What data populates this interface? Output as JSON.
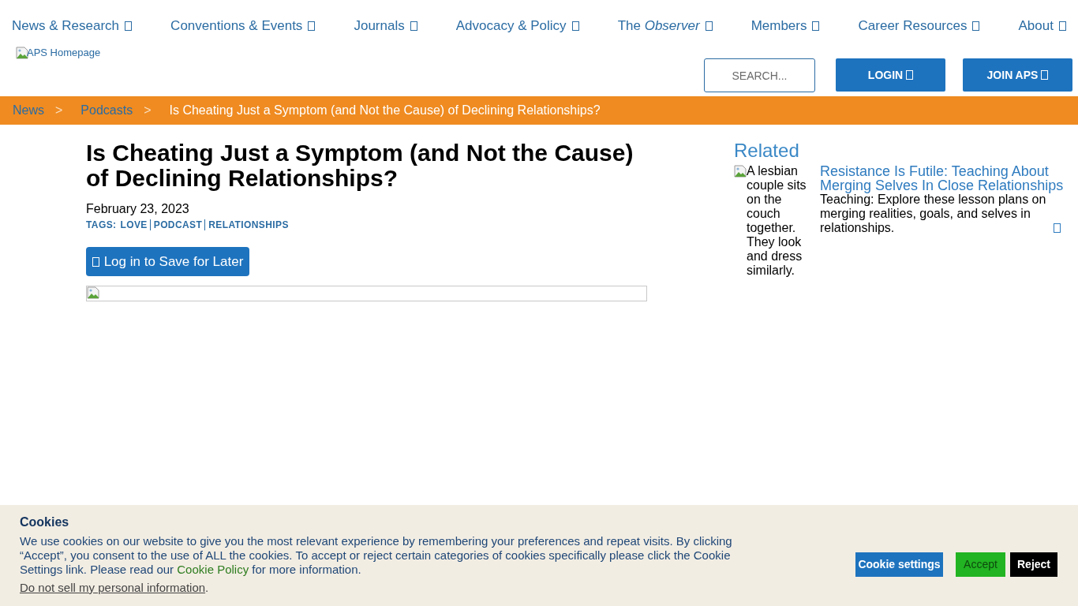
{
  "nav": {
    "items": [
      {
        "label": "News & Research"
      },
      {
        "label": "Conventions & Events"
      },
      {
        "label": "Journals"
      },
      {
        "label": "Advocacy & Policy"
      },
      {
        "label": "The *Observer*"
      },
      {
        "label": "Members"
      },
      {
        "label": "Career Resources"
      },
      {
        "label": "About"
      }
    ]
  },
  "header": {
    "logo_alt": "APS Homepage",
    "search": {
      "placeholder": "SEARCH..."
    },
    "buttons": [
      {
        "label": "LOGIN"
      },
      {
        "label": "JOIN APS"
      }
    ]
  },
  "breadcrumb": [
    {
      "label": "News",
      "kind": "link"
    },
    {
      "label": ">",
      "kind": "separator"
    },
    {
      "label": "Podcasts",
      "kind": "link"
    },
    {
      "label": ">",
      "kind": "separator"
    },
    {
      "label": "Is Cheating Just a Symptom (and Not the Cause) of Declining Relationships?",
      "kind": "current"
    }
  ],
  "article": {
    "title": "Is Cheating Just a Symptom (and Not the Cause) of Declining Relationships?",
    "date": "February 23, 2023",
    "tags_label": "TAGS:",
    "tags": [
      "LOVE",
      "PODCAST",
      "RELATIONSHIPS"
    ],
    "save_button": "Log in to Save for Later"
  },
  "related": {
    "heading": "Related",
    "items": [
      {
        "image_alt": "A lesbian couple sits on the couch together. They look and dress similarly.",
        "title": "Resistance Is Futile: Teaching About Merging Selves In Close Relationships",
        "summary": "Teaching: Explore these lesson plans on merging realities, goals, and selves in relationships."
      }
    ]
  },
  "cookie_banner": {
    "title": "Cookies",
    "text_before": "We use cookies on our website to give you the most relevant experience by remembering your preferences and repeat visits. By clicking “Accept”, you consent to the use of ALL the cookies. To accept or reject certain categories of cookies specifically please click the Cookie Settings link. Please read our ",
    "policy_link": "Cookie Policy",
    "text_after": " for more information.",
    "opt_out_link": "Do not sell my personal information",
    "opt_out_suffix": ".",
    "buttons": [
      {
        "label": "Cookie settings",
        "kind": "settings"
      },
      {
        "label": "Accept",
        "kind": "accept"
      },
      {
        "label": "Reject",
        "kind": "reject"
      }
    ]
  }
}
